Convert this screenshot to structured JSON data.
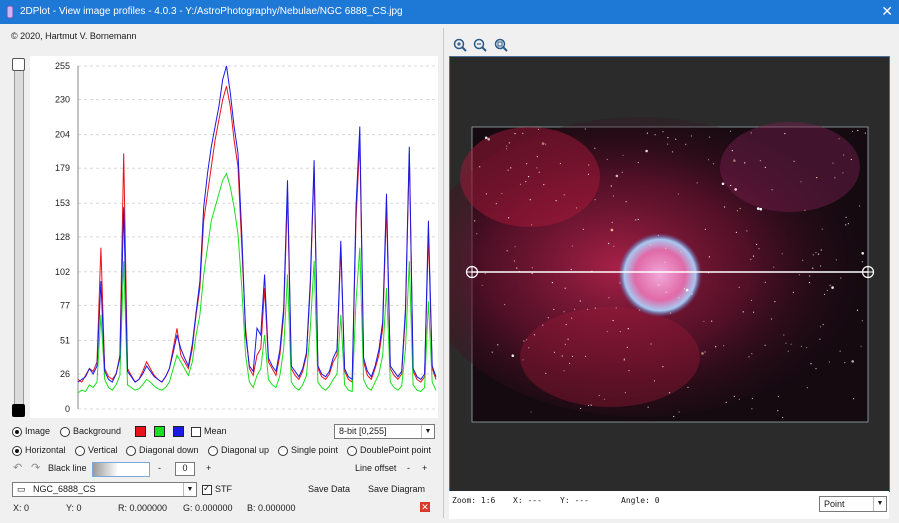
{
  "window": {
    "title": "2DPlot - View image profiles - 4.0.3 - Y:/AstroPhotography/Nebulae/NGC 6888_CS.jpg",
    "close_glyph": "✕",
    "app_icon": "app-icon",
    "close_icon": "close-icon"
  },
  "copyright": "© 2020, Hartmut V. Bornemann",
  "colors": {
    "titlebar": "#1e78d6",
    "red": "#e8141b",
    "green": "#18e01c",
    "blue": "#1a1ae6",
    "image_bg": "#2b2b2b"
  },
  "chart_data": {
    "type": "line",
    "y_ticks": [
      "255",
      "230",
      "204",
      "179",
      "153",
      "128",
      "102",
      "77",
      "51",
      "26",
      "0"
    ],
    "ylim": [
      0,
      255
    ],
    "grid": true,
    "series": [
      {
        "color": "#e8141b",
        "values": [
          22,
          20,
          25,
          30,
          28,
          35,
          120,
          30,
          24,
          22,
          26,
          40,
          190,
          30,
          25,
          20,
          22,
          28,
          35,
          30,
          25,
          22,
          20,
          24,
          30,
          45,
          60,
          40,
          35,
          30,
          45,
          70,
          90,
          140,
          160,
          180,
          200,
          215,
          230,
          240,
          225,
          200,
          180,
          120,
          60,
          30,
          25,
          40,
          45,
          90,
          35,
          30,
          25,
          40,
          70,
          160,
          30,
          25,
          22,
          28,
          40,
          90,
          180,
          30,
          24,
          22,
          26,
          35,
          40,
          120,
          28,
          22,
          20,
          140,
          200,
          35,
          25,
          22,
          30,
          40,
          60,
          150,
          30,
          25,
          22,
          26,
          70,
          190,
          28,
          22,
          20,
          24,
          130,
          30,
          22
        ]
      },
      {
        "color": "#18e01c",
        "values": [
          12,
          14,
          13,
          18,
          16,
          20,
          70,
          22,
          16,
          14,
          18,
          25,
          110,
          18,
          16,
          14,
          15,
          18,
          22,
          20,
          17,
          15,
          14,
          16,
          20,
          30,
          40,
          35,
          30,
          25,
          35,
          55,
          70,
          100,
          120,
          140,
          150,
          160,
          170,
          175,
          165,
          150,
          130,
          90,
          40,
          20,
          16,
          25,
          30,
          55,
          22,
          18,
          16,
          25,
          45,
          100,
          20,
          16,
          14,
          18,
          25,
          60,
          110,
          20,
          16,
          14,
          17,
          22,
          26,
          70,
          18,
          14,
          13,
          80,
          120,
          22,
          16,
          14,
          20,
          26,
          40,
          90,
          20,
          16,
          14,
          17,
          45,
          110,
          18,
          14,
          13,
          16,
          80,
          20,
          14
        ]
      },
      {
        "color": "#1a1ae6",
        "values": [
          20,
          22,
          24,
          30,
          26,
          32,
          95,
          28,
          22,
          20,
          26,
          38,
          150,
          28,
          24,
          20,
          22,
          26,
          32,
          28,
          24,
          22,
          20,
          24,
          30,
          42,
          55,
          45,
          38,
          32,
          48,
          72,
          95,
          150,
          175,
          195,
          210,
          225,
          245,
          255,
          235,
          210,
          190,
          130,
          55,
          32,
          28,
          60,
          55,
          100,
          38,
          32,
          28,
          44,
          75,
          170,
          32,
          28,
          24,
          30,
          42,
          95,
          185,
          32,
          26,
          24,
          28,
          38,
          44,
          125,
          30,
          24,
          22,
          150,
          210,
          38,
          28,
          24,
          32,
          44,
          65,
          160,
          32,
          28,
          24,
          28,
          75,
          195,
          30,
          24,
          22,
          26,
          140,
          32,
          24
        ]
      }
    ]
  },
  "controls": {
    "source_image": "Image",
    "source_background": "Background",
    "mean_label": "Mean",
    "bit_depth": "8-bit [0,255]",
    "profiles": {
      "horizontal": "Horizontal",
      "vertical": "Vertical",
      "diagonal_down": "Diagonal down",
      "diagonal_up": "Diagonal up",
      "single_point": "Single point",
      "doublepoint": "DoublePoint point"
    },
    "black_line_label": "Black line",
    "minus": "-",
    "plus": "+",
    "black_line_value": "0",
    "line_offset_label": "Line offset",
    "image_selector": "NGC_6888_CS",
    "stf_label": "STF",
    "save_data": "Save Data",
    "save_diagram": "Save Diagram"
  },
  "status": {
    "x": "X: 0",
    "y": "Y: 0",
    "r": "R: 0.000000",
    "g": "G: 0.000000",
    "b": "B: 0.000000"
  },
  "viewer": {
    "zoom": "Zoom: 1:6",
    "x": "X: ---",
    "y": "Y: ---",
    "angle": "Angle: 0",
    "mode": "Point"
  }
}
